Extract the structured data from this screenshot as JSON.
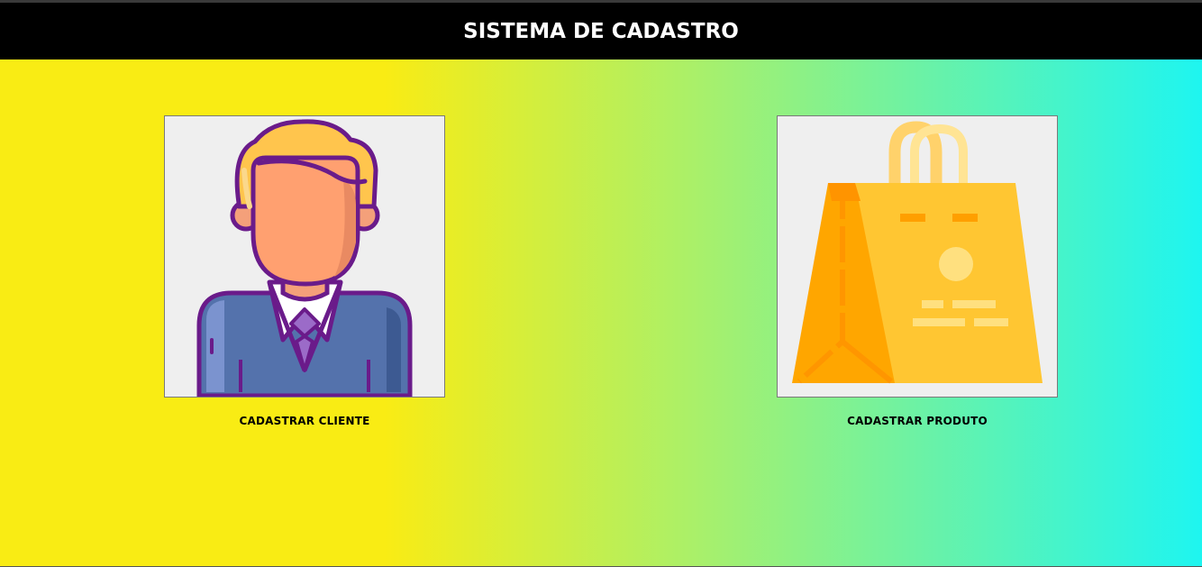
{
  "header": {
    "title": "SISTEMA DE CADASTRO"
  },
  "cards": [
    {
      "label": "CADASTRAR CLIENTE",
      "icon": "customer-avatar-icon"
    },
    {
      "label": "CADASTRAR PRODUTO",
      "icon": "shopping-bag-icon"
    }
  ],
  "colors": {
    "header_bg": "#000000",
    "gradient_start": "#f9ec14",
    "gradient_mid": "#a9f06a",
    "gradient_end": "#1ef5f0",
    "card_bg": "#efefef"
  }
}
